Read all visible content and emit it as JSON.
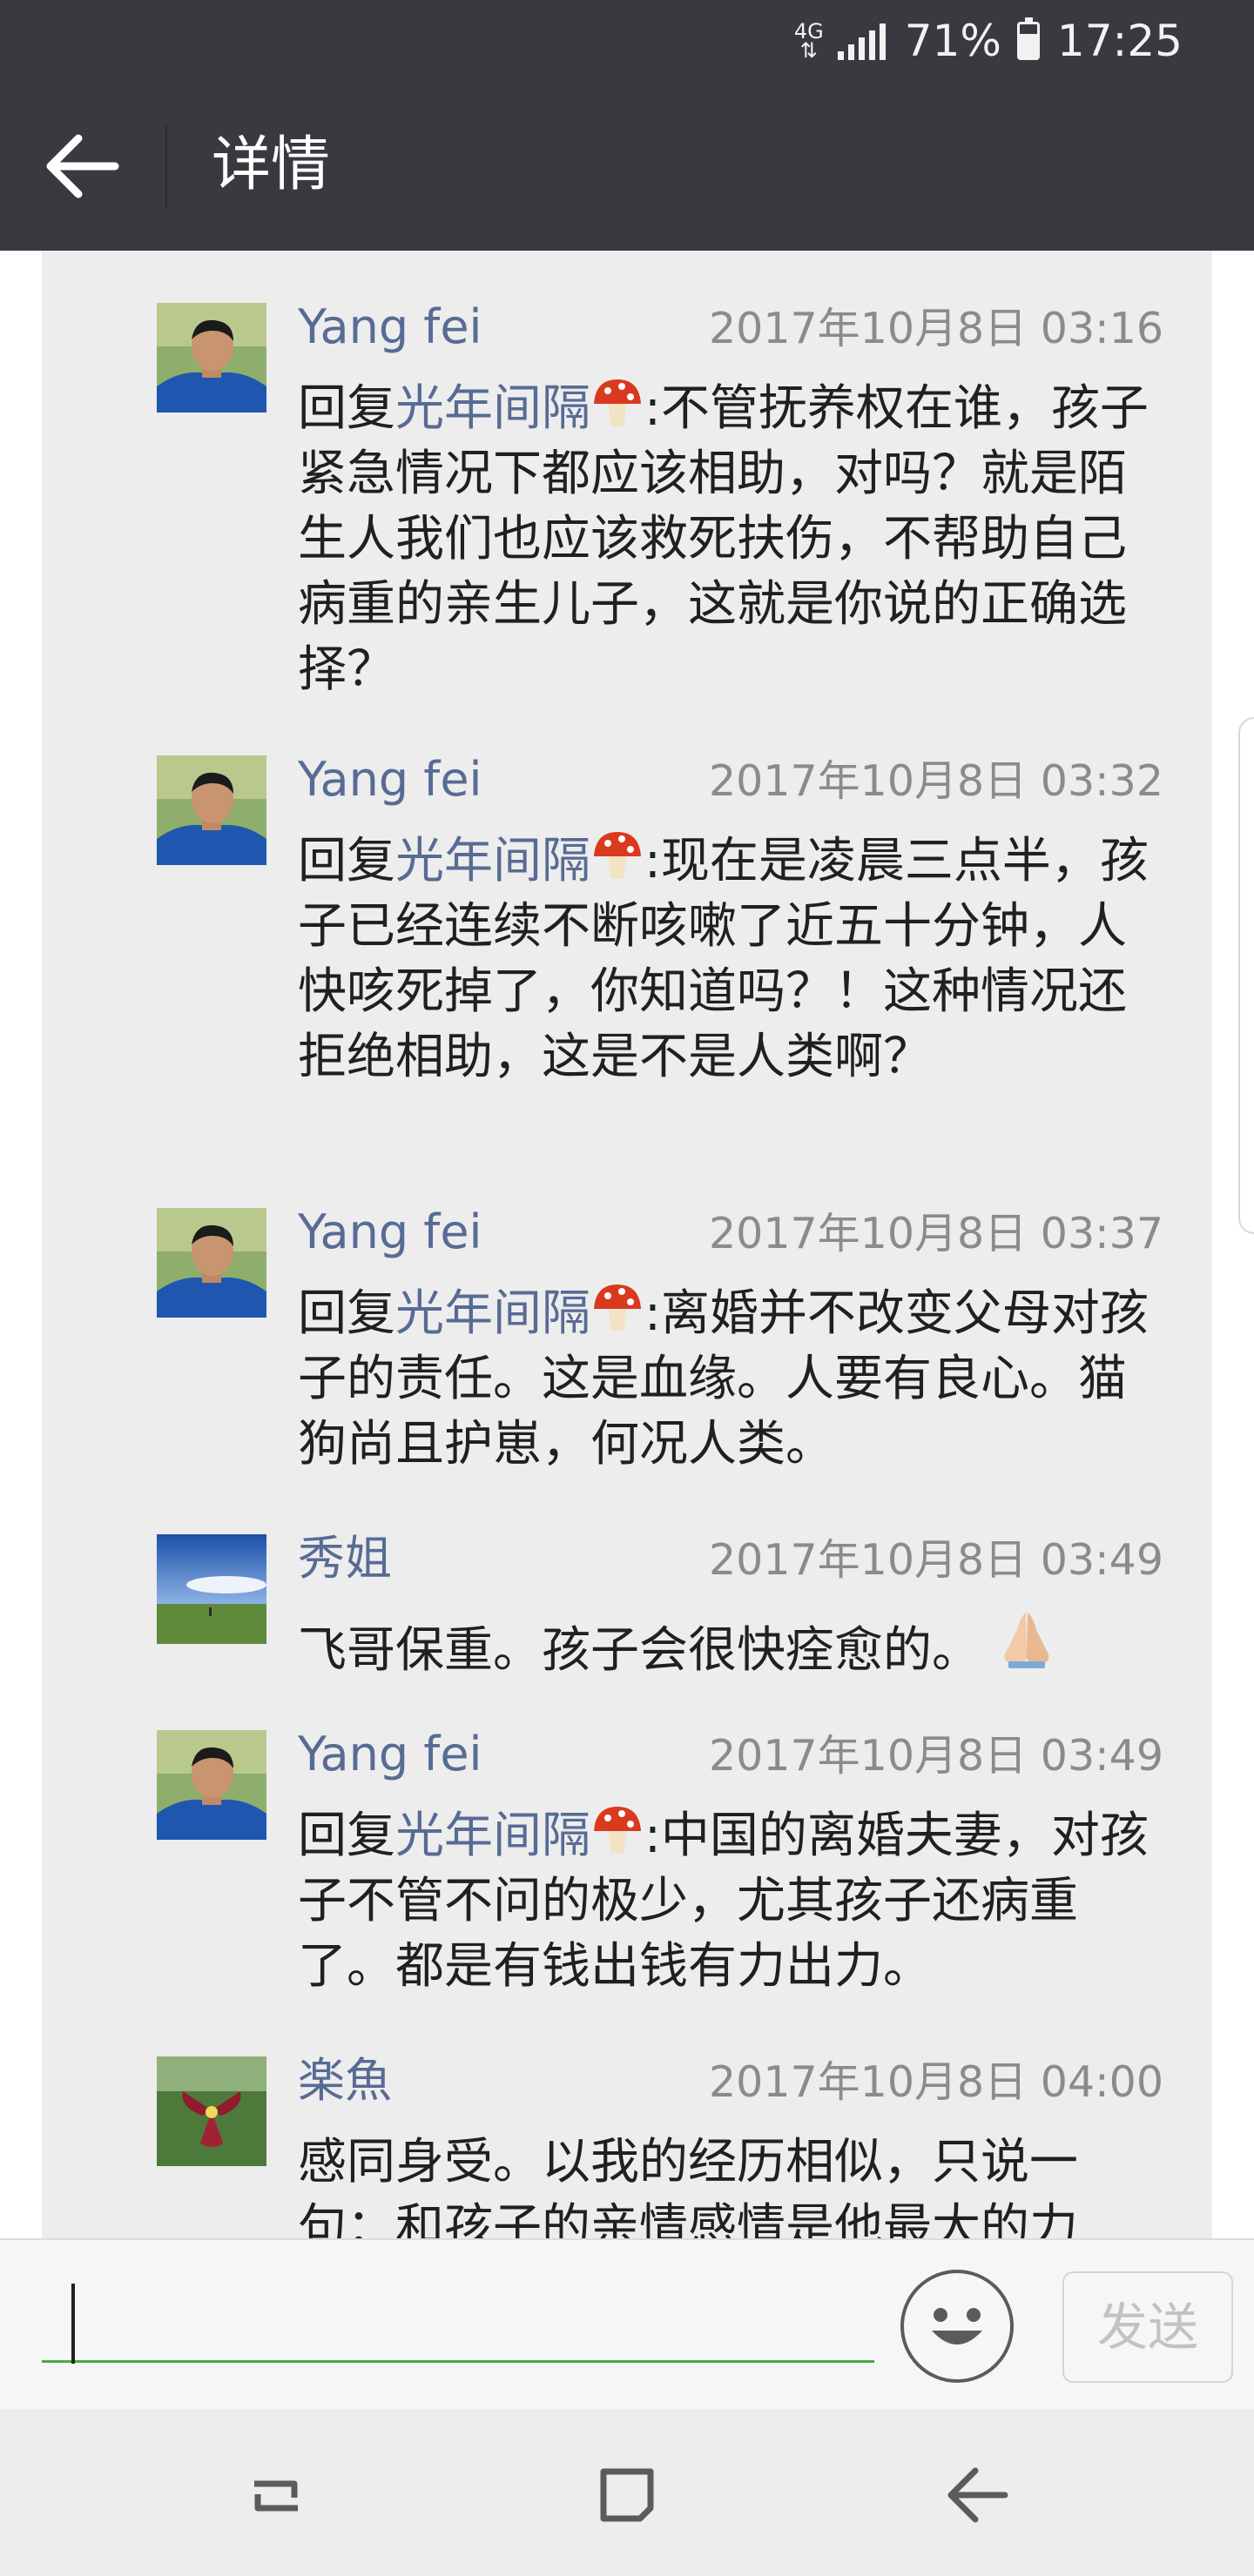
{
  "status_bar": {
    "network_top": "4G",
    "network_bottom": "⇅",
    "battery": "71%",
    "time": "17:25"
  },
  "header": {
    "title": "详情",
    "back_icon": "back-arrow-icon"
  },
  "comments": [
    {
      "name": "Yang fei",
      "time": "2017年10月8日 03:16",
      "reply_prefix": "回复",
      "reply_to": "光年间隔",
      "text": ":不管抚养权在谁，孩子紧急情况下都应该相助，对吗？就是陌生人我们也应该救死扶伤，不帮助自己病重的亲生儿子，这就是你说的正确选择？",
      "avatar": "man-portrait"
    },
    {
      "name": "Yang fei",
      "time": "2017年10月8日 03:32",
      "reply_prefix": "回复",
      "reply_to": "光年间隔",
      "text": ":现在是凌晨三点半，孩子已经连续不断咳嗽了近五十分钟，人快咳死掉了，你知道吗？！这种情况还拒绝相助，这是不是人类啊？",
      "avatar": "man-portrait"
    },
    {
      "name": "Yang fei",
      "time": "2017年10月8日 03:37",
      "reply_prefix": "回复",
      "reply_to": "光年间隔",
      "text": ":离婚并不改变父母对孩子的责任。这是血缘。人要有良心。猫狗尚且护崽，何况人类。",
      "avatar": "man-portrait"
    },
    {
      "name": "秀姐",
      "time": "2017年10月8日 03:49",
      "reply_prefix": "",
      "reply_to": "",
      "text": "飞哥保重。孩子会很快痊愈的。",
      "avatar": "landscape"
    },
    {
      "name": "Yang fei",
      "time": "2017年10月8日 03:49",
      "reply_prefix": "回复",
      "reply_to": "光年间隔",
      "text": ":中国的离婚夫妻，对孩子不管不问的极少，尤其孩子还病重了。都是有钱出钱有力出力。",
      "avatar": "man-portrait"
    },
    {
      "name": "楽魚",
      "time": "2017年10月8日 04:00",
      "reply_prefix": "",
      "reply_to": "",
      "text": "感同身受。以我的经历相似，只说一句：和孩子的亲情感情是他最大的力",
      "avatar": "red-flower"
    }
  ],
  "input_bar": {
    "value": "",
    "emoji_icon": "smiley-icon",
    "send_label": "发送"
  },
  "nav_bar": {
    "recents_icon": "recents-icon",
    "home_icon": "home-icon",
    "back_icon": "back-icon"
  },
  "colors": {
    "bar_dark": "#393a3f",
    "link_blue": "#576b95",
    "panel_gray": "#ededed",
    "input_green": "#4caa3c"
  }
}
